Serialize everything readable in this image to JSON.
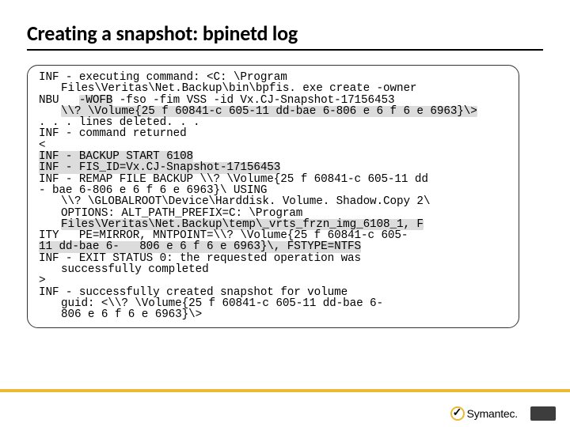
{
  "title": "Creating a snapshot: bpinetd log",
  "log": {
    "l01": "INF - executing command: <C: \\Program",
    "l02": "Files\\Veritas\\Net.Backup\\bin\\bpfis. exe create -owner",
    "l03a": "NBU   ",
    "l03b": "-WOFB",
    "l03c": " -fso -fim VSS -id Vx.CJ-Snapshot-17156453",
    "l04": "\\\\? \\Volume{25 f 60841-c 605-11 dd-bae 6-806 e 6 f 6 e 6963}\\>",
    "l05": ". . . lines deleted. . .",
    "l06": "INF - command returned",
    "l07": "<",
    "l08": "INF - BACKUP START 6108",
    "l09": "INF - FIS_ID=Vx.CJ-Snapshot-17156453",
    "l10": "INF - REMAP FILE BACKUP \\\\? \\Volume{25 f 60841-c 605-11 dd",
    "l11": "- bae 6-806 e 6 f 6 e 6963}\\ USING",
    "l12": "\\\\? \\GLOBALROOT\\Device\\Harddisk. Volume. Shadow.Copy 2\\",
    "l13": "OPTIONS: ALT_PATH_PREFIX=C: \\Program",
    "l14": "Files\\Veritas\\Net.Backup\\temp\\_vrts_frzn_img_6108_1, F",
    "l15": "ITY   PE=MIRROR, MNTPOINT=\\\\? \\Volume{25 f 60841-c 605-",
    "l16": "11 dd-bae 6-   806 e 6 f 6 e 6963}\\, FSTYPE=NTFS",
    "l17": "INF - EXIT STATUS 0: the requested operation was",
    "l18": "successfully completed",
    "l19": ">",
    "l20": "INF - successfully created snapshot for volume",
    "l21": "guid: <\\\\? \\Volume{25 f 60841-c 605-11 dd-bae 6-",
    "l22": "806 e 6 f 6 e 6963}\\>"
  },
  "brand": "Symantec."
}
